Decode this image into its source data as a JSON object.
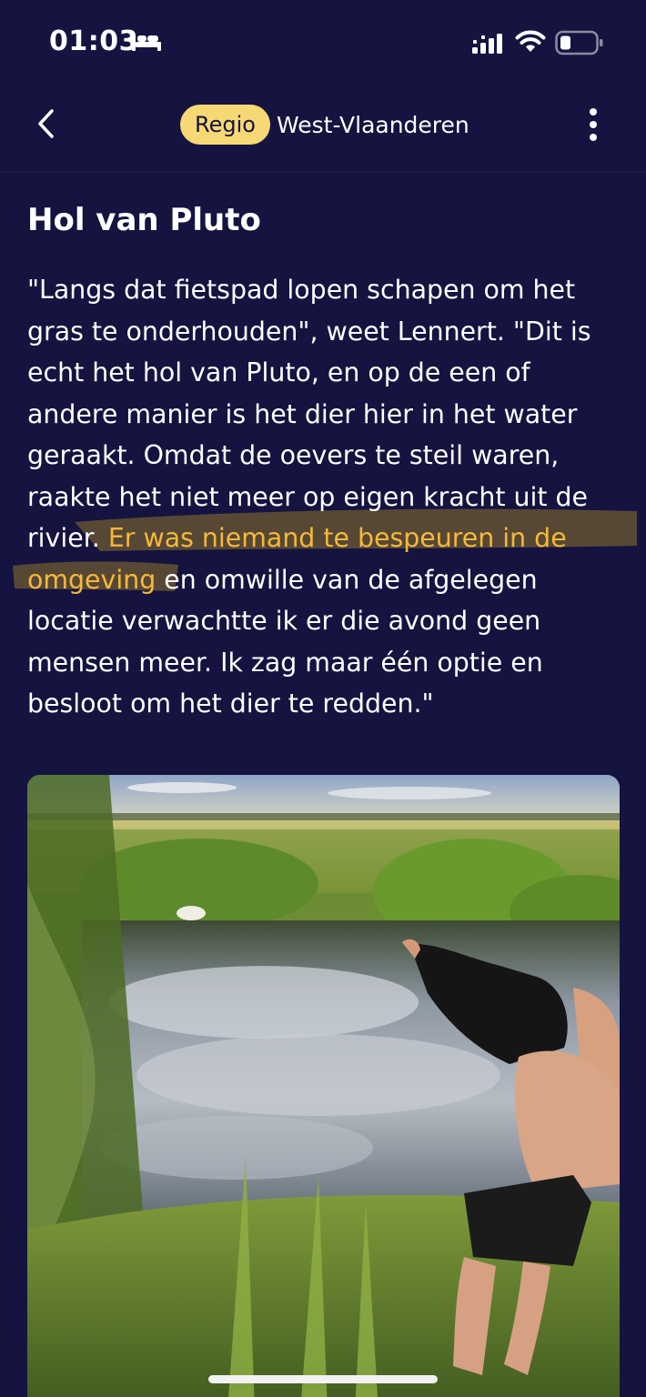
{
  "status_bar": {
    "time": "01:03",
    "icons": [
      "bed-icon",
      "cellular-signal-icon",
      "wifi-icon",
      "battery-icon"
    ]
  },
  "nav": {
    "back_icon": "chevron-left-icon",
    "region_label": "Regio",
    "region_name": "West-Vlaanderen",
    "more_icon": "vertical-ellipsis-icon"
  },
  "article": {
    "title": "Hol van Pluto",
    "text_before": "\"Langs dat fietspad lopen schapen om het gras te onderhouden\", weet Lennert. \"Dit is echt het hol van Pluto, en op de een of andere manier is het dier hier in het water geraakt. Omdat de oevers te steil waren, raakte het niet meer op eigen kracht uit de rivier. ",
    "text_highlighted": "Er was niemand te bespeuren in de omgeving",
    "text_after": " en omwille van de afgelegen locatie verwachtte ik er die avond geen mensen meer. Ik zag maar één optie en besloot om het dier te redden.\""
  },
  "photo": {
    "subject": "man pulling off black shirt on riverbank, sheep in the water, field and sky reflected"
  },
  "colors": {
    "background": "#15133f",
    "pill": "#f6d875",
    "highlight_text": "#f5b93a",
    "marker": "#a9892a"
  }
}
